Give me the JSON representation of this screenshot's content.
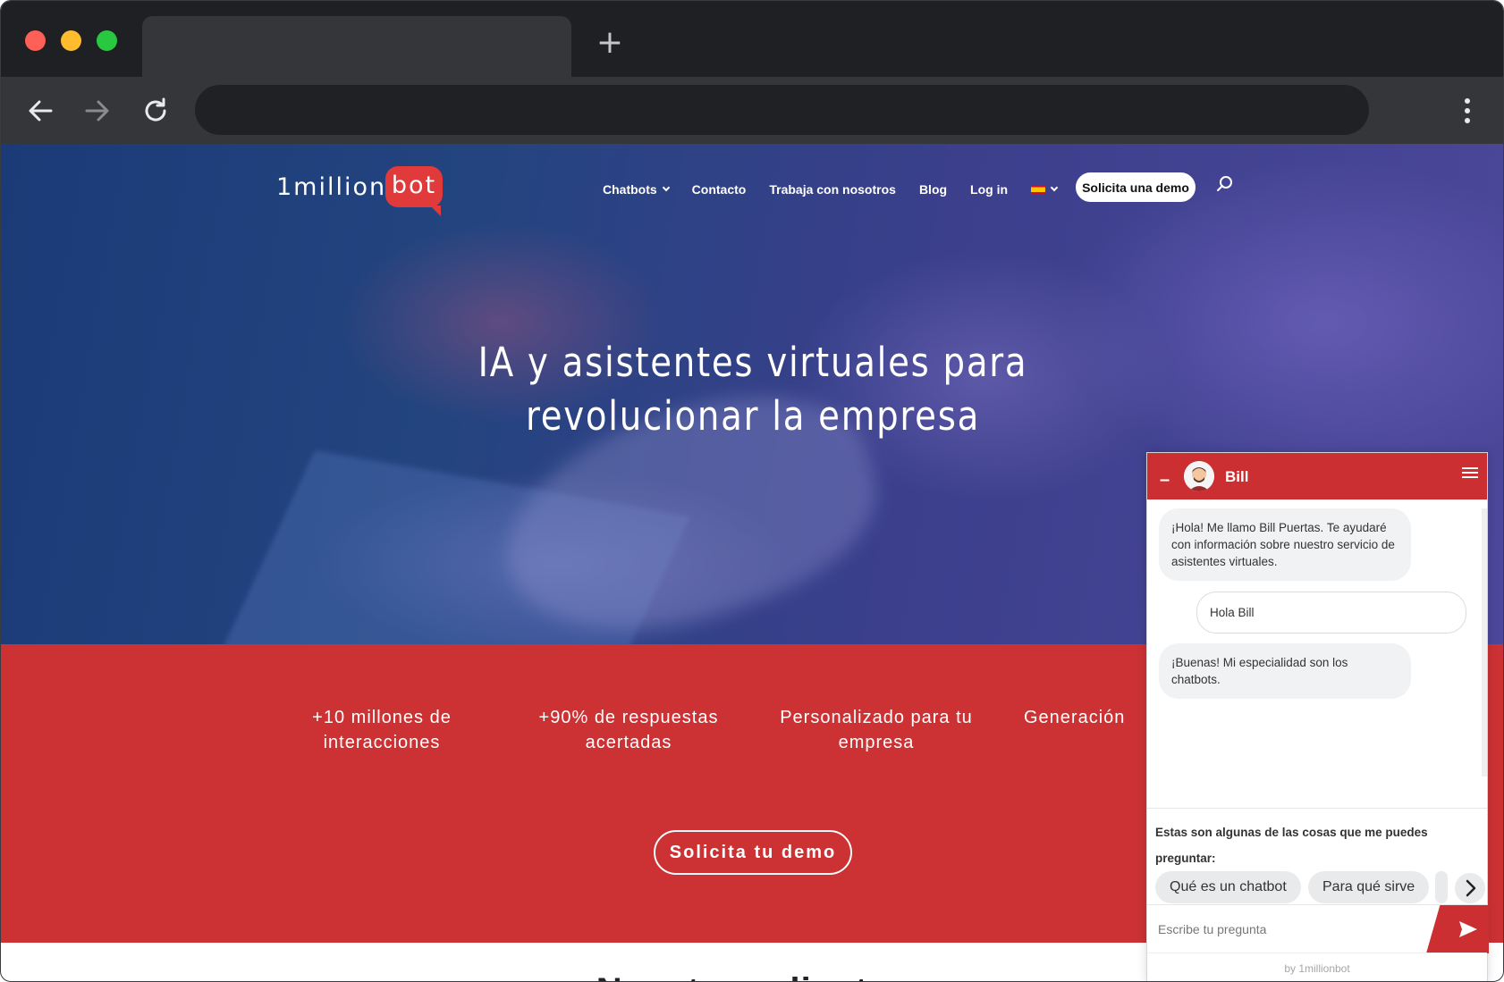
{
  "site": {
    "logo_prefix": "1million",
    "logo_suffix": "bot",
    "nav": [
      {
        "label": "Chatbots",
        "dropdown": true
      },
      {
        "label": "Contacto",
        "dropdown": false
      },
      {
        "label": "Trabaja con nosotros",
        "dropdown": false
      },
      {
        "label": "Blog",
        "dropdown": false
      },
      {
        "label": "Log in",
        "dropdown": false
      }
    ],
    "language_flag": "spain-flag-icon",
    "demo_button": "Solicita una demo",
    "hero_title_line1": "IA y asistentes virtuales para",
    "hero_title_line2": "revolucionar la empresa",
    "stats": [
      {
        "line1": "+10 millones de",
        "line2": "interacciones"
      },
      {
        "line1": "+90% de respuestas",
        "line2": "acertadas"
      },
      {
        "line1": "Personalizado para tu",
        "line2": "empresa"
      },
      {
        "line1": "Generación",
        "line2": ""
      }
    ],
    "cta_button": "Solicita tu demo",
    "next_section_title": "Nuestros clientes",
    "colors": {
      "brand_red": "#cc3133",
      "hero_blue": "#23447f"
    }
  },
  "chat": {
    "bot_name": "Bill",
    "messages": [
      {
        "from": "bot",
        "text": "¡Hola! Me llamo Bill Puertas. Te ayudaré con información sobre nuestro servicio de asistentes virtuales."
      },
      {
        "from": "user",
        "text": "Hola Bill"
      },
      {
        "from": "bot",
        "text": "¡Buenas! Mi especialidad son los chatbots."
      }
    ],
    "suggestions_intro": "Estas son algunas de las cosas que me puedes preguntar:",
    "suggestions": [
      "Qué es un chatbot",
      "Para qué sirve"
    ],
    "input_placeholder": "Escribe tu pregunta",
    "footer": "by 1millionbot"
  }
}
